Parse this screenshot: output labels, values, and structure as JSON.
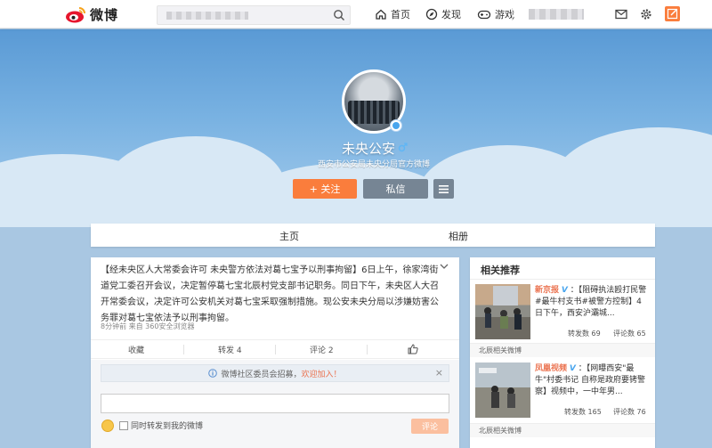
{
  "nav": {
    "logo_text": "微博",
    "home": "首页",
    "discover": "发现",
    "games": "游戏"
  },
  "profile": {
    "name": "未央公安",
    "intro": "西安市公安局未央分局官方微博",
    "follow_label": "+ 关注",
    "message_label": "私信"
  },
  "tabs": [
    "主页",
    "相册"
  ],
  "post": {
    "text": "【经未央区人大常委会许可 未央警方依法对葛七宝予以刑事拘留】6日上午，徐家湾街道党工委召开会议，决定暂停葛七宝北辰村党支部书记职务。同日下午，未央区人大召开常委会议，决定许可公安机关对葛七宝采取强制措施。现公安未央分局以涉嫌妨害公务罪对葛七宝依法予以刑事拘留。",
    "meta": "8分钟前 来自 360安全浏览器",
    "actions": {
      "collect": "收藏",
      "repost": "转发 4",
      "comment": "评论 2"
    },
    "notice_text": "微博社区委员会招募，",
    "notice_link": "欢迎加入！",
    "sync_label": "同时转发到我的微博",
    "comment_button": "评论"
  },
  "side": {
    "title": "相关推荐",
    "items": [
      {
        "source": "新京报",
        "text": "：【阻碍执法殴打民警 #最牛村支书#被警方控制】4日下午，西安沪灞城...",
        "reposts": "转发数 69",
        "comments": "评论数 65",
        "footer": "北辰相关微博"
      },
      {
        "source": "凤凰视频",
        "text": "：【网曝西安\"最牛\"村委书记 自称是政府要铐警察】视频中，一中年男...",
        "reposts": "转发数 165",
        "comments": "评论数 76",
        "footer": "北辰相关微博"
      }
    ]
  },
  "colors": {
    "accent": "#fa7d3c",
    "link": "#eb7350",
    "verified": "#48a5ee"
  }
}
